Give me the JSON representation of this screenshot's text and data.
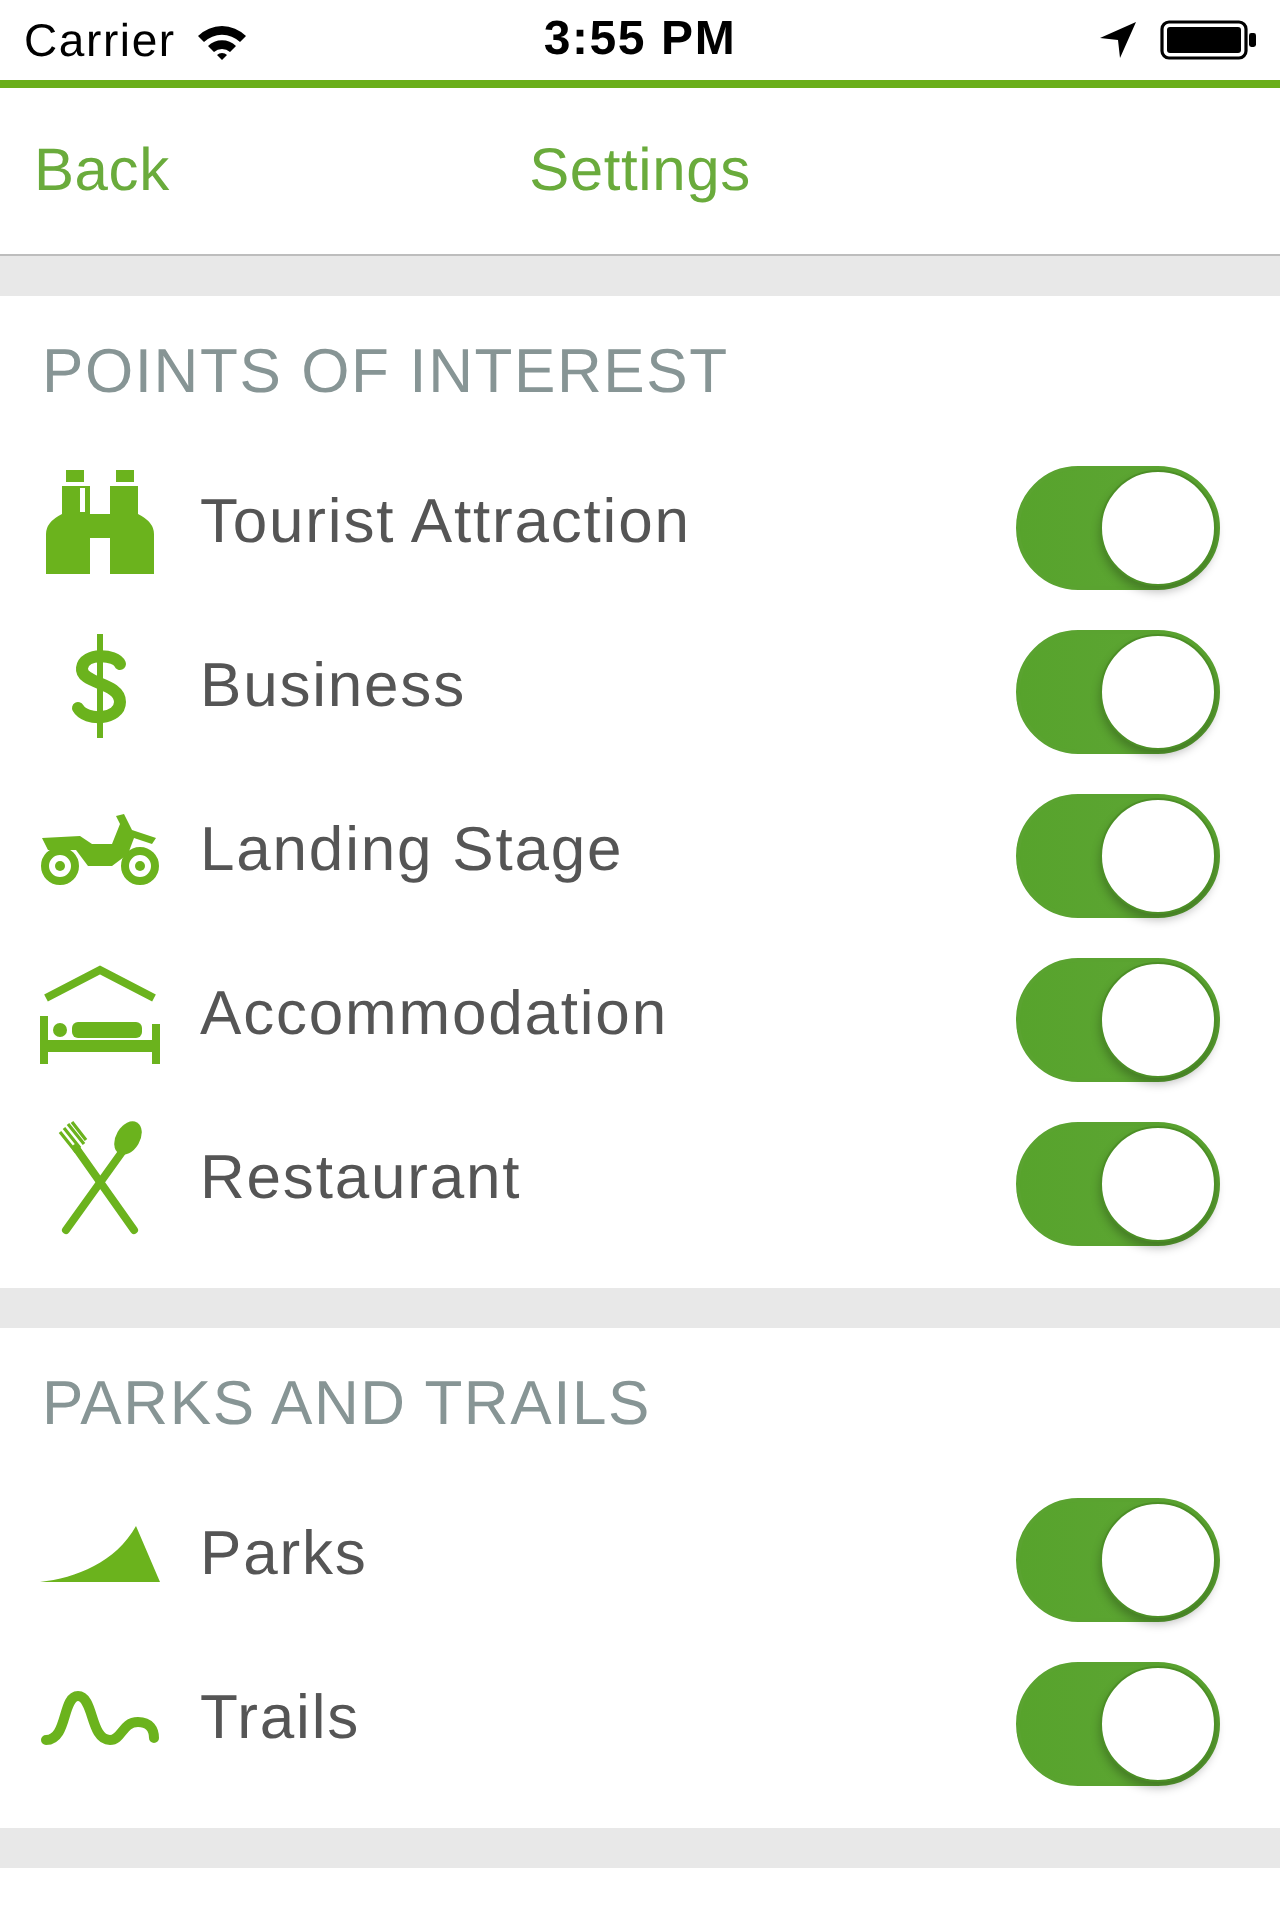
{
  "status_bar": {
    "carrier": "Carrier",
    "time": "3:55 PM"
  },
  "nav_bar": {
    "back": "Back",
    "title": "Settings"
  },
  "sections": [
    {
      "title": "POINTS OF INTEREST",
      "items": [
        {
          "label": "Tourist Attraction",
          "kind": "binoculars",
          "on": true
        },
        {
          "label": "Business",
          "kind": "dollar",
          "on": true
        },
        {
          "label": "Landing Stage",
          "kind": "motorbike",
          "on": true
        },
        {
          "label": "Accommodation",
          "kind": "bed",
          "on": true
        },
        {
          "label": "Restaurant",
          "kind": "cutlery",
          "on": true
        }
      ]
    },
    {
      "title": "PARKS AND TRAILS",
      "items": [
        {
          "label": "Parks",
          "kind": "hill",
          "on": true
        },
        {
          "label": "Trails",
          "kind": "trail",
          "on": true
        }
      ]
    }
  ]
}
